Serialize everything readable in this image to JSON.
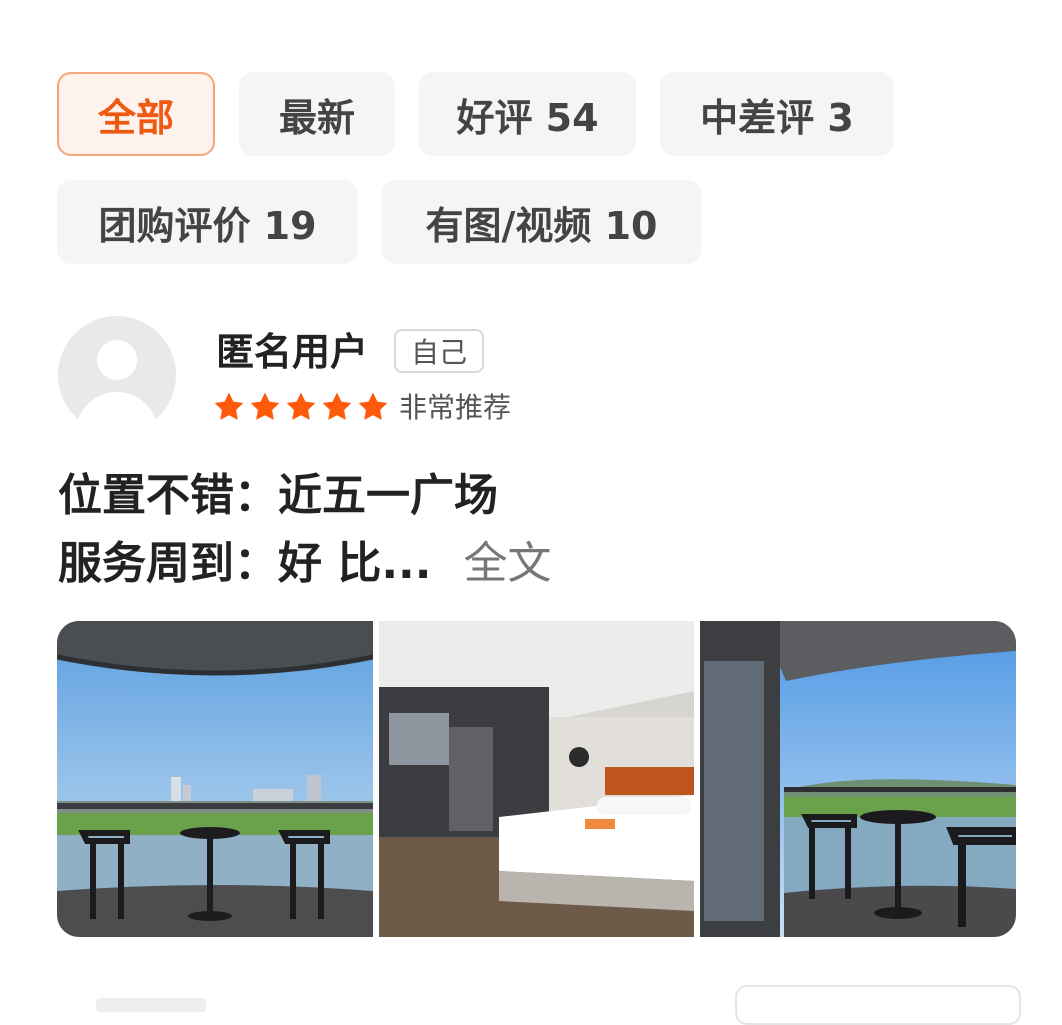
{
  "filters": {
    "row1": [
      {
        "label": "全部",
        "active": true
      },
      {
        "label": "最新",
        "active": false
      },
      {
        "label": "好评 54",
        "active": false
      },
      {
        "label": "中差评 3",
        "active": false
      }
    ],
    "row2": [
      {
        "label": "团购评价 19",
        "active": false
      },
      {
        "label": "有图/视频 10",
        "active": false
      }
    ]
  },
  "review": {
    "user_name": "匿名用户",
    "self_tag": "自己",
    "stars": 5,
    "rating_text": "非常推荐",
    "line1": "位置不错：近五一广场",
    "line2": "服务周到：好 比...",
    "more_label": "全文",
    "photos": [
      {
        "icon": "balcony-city-view-photo"
      },
      {
        "icon": "hotel-room-bed-photo"
      },
      {
        "icon": "balcony-river-view-photo"
      }
    ]
  },
  "colors": {
    "accent": "#ee5a12",
    "star": "#ff5a0a",
    "chip_bg": "#f5f5f5",
    "active_chip_bg": "#fdf3ec"
  }
}
